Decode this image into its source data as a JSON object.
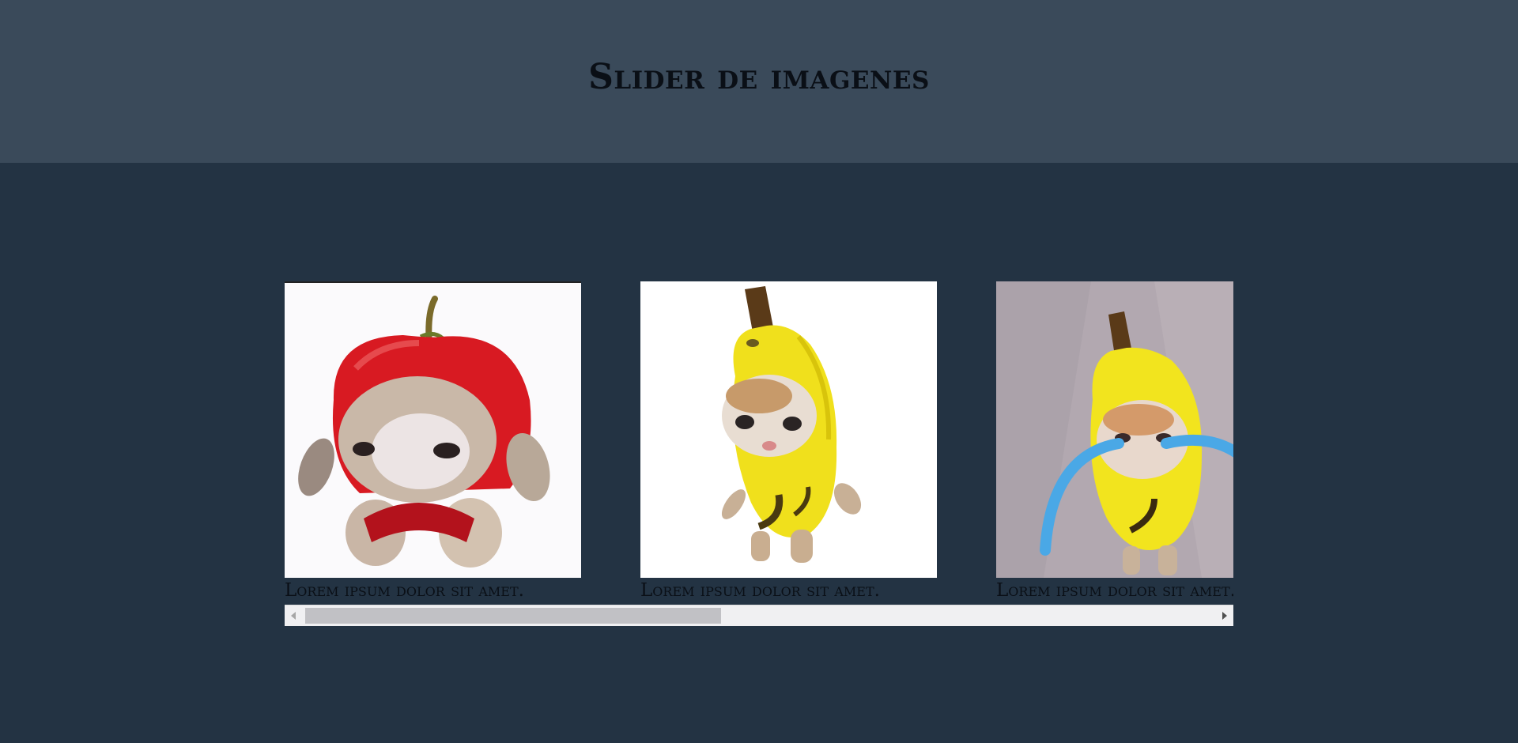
{
  "header": {
    "title": "Slider de imagenes",
    "background": "#3a4a5a"
  },
  "page": {
    "background": "#233343"
  },
  "slider": {
    "slides": [
      {
        "image": "apple-cat-image",
        "caption": "Lorem ipsum dolor sit amet."
      },
      {
        "image": "banana-cat-image",
        "caption": "Lorem ipsum dolor sit amet."
      },
      {
        "image": "crying-banana-cat-image",
        "caption": "Lorem ipsum dolor sit amet."
      }
    ]
  }
}
